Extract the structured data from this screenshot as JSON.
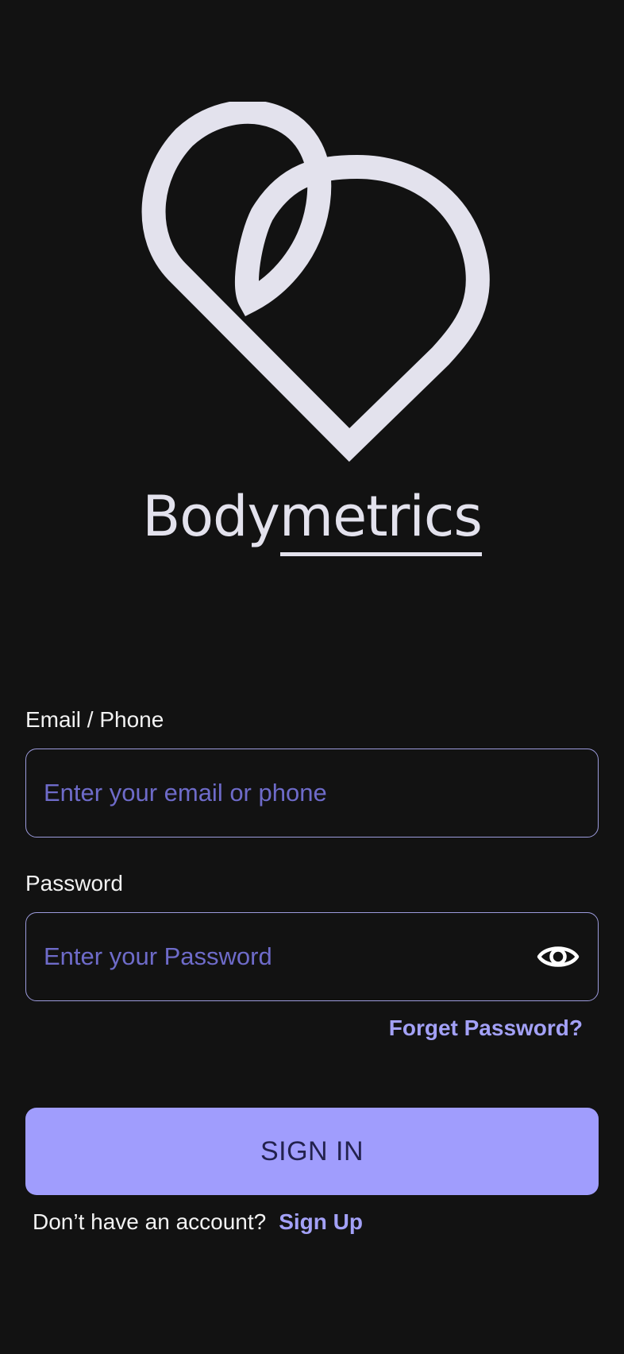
{
  "brand": {
    "name_part1": "Body",
    "name_part2": "metrics",
    "logo_icon": "heart-loop-icon"
  },
  "form": {
    "email": {
      "label": "Email / Phone",
      "placeholder": "Enter your email or phone",
      "value": ""
    },
    "password": {
      "label": "Password",
      "placeholder": "Enter your Password",
      "value": "",
      "toggle_icon": "eye-icon"
    },
    "forgot_label": "Forget Password?",
    "submit_label": "SIGN IN"
  },
  "footer": {
    "prompt": "Don’t have an account?",
    "link_label": "Sign Up"
  },
  "colors": {
    "background": "#121212",
    "accent": "#A09DFD",
    "placeholder": "#6E6BC9",
    "logo": "#E3E2ED",
    "button_text": "#23224E"
  }
}
